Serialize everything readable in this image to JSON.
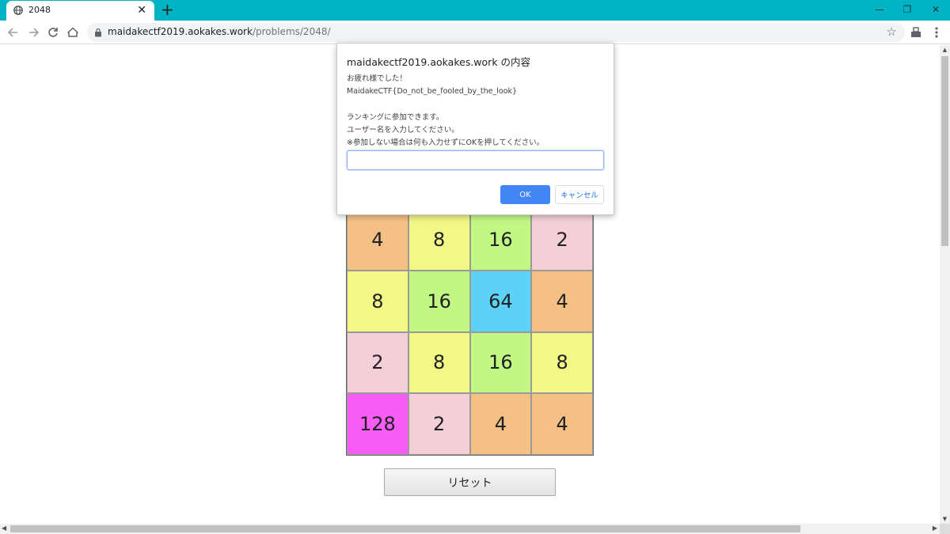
{
  "browser": {
    "tab_title": "2048",
    "tab_close": "✕",
    "new_tab": "+",
    "url_host": "maidakectf2019.aokakes.work",
    "url_path": "/problems/2048/",
    "icons": {
      "back": "back-arrow-icon",
      "forward": "forward-arrow-icon",
      "reload": "reload-icon",
      "home": "home-icon",
      "lock": "lock-icon",
      "star": "star-icon",
      "extension": "extension-icon",
      "menu": "kebab-menu-icon"
    },
    "window": {
      "minimize": "—",
      "maximize": "❐",
      "close": "✕"
    }
  },
  "dialog": {
    "title": "maidakectf2019.aokakes.work の内容",
    "message": "お疲れ様でした！\nMaidakeCTF{Do_not_be_fooled_by_the_look}\n\nランキングに参加できます。\nユーザー名を入力してください。\n※参加しない場合は何も入力せずにOKを押してください。",
    "input_value": "",
    "ok_label": "OK",
    "cancel_label": "キャンセル",
    "ok_color": "#4285f4"
  },
  "board": {
    "rows": [
      [
        {
          "value": "",
          "color": "#f4f4f4"
        },
        {
          "value": "",
          "color": "#f4f4f4"
        },
        {
          "value": "",
          "color": "#f4f4f4"
        },
        {
          "value": "",
          "color": "#f4f4f4"
        }
      ],
      [
        {
          "value": "4",
          "color": "#f5c084"
        },
        {
          "value": "8",
          "color": "#f3f785"
        },
        {
          "value": "16",
          "color": "#c2f784"
        },
        {
          "value": "2",
          "color": "#f5cfd8"
        }
      ],
      [
        {
          "value": "8",
          "color": "#f3f785"
        },
        {
          "value": "16",
          "color": "#c2f784"
        },
        {
          "value": "64",
          "color": "#5cd2f7"
        },
        {
          "value": "4",
          "color": "#f5c084"
        }
      ],
      [
        {
          "value": "2",
          "color": "#f5cfd8"
        },
        {
          "value": "8",
          "color": "#f3f785"
        },
        {
          "value": "16",
          "color": "#c2f784"
        },
        {
          "value": "8",
          "color": "#f3f785"
        }
      ],
      [
        {
          "value": "128",
          "color": "#f75cf5"
        },
        {
          "value": "2",
          "color": "#f5cfd8"
        },
        {
          "value": "4",
          "color": "#f5c084"
        },
        {
          "value": "4",
          "color": "#f5c084"
        }
      ]
    ],
    "visible_rows": [
      1,
      2,
      3,
      4
    ]
  },
  "reset_label": "リセット"
}
